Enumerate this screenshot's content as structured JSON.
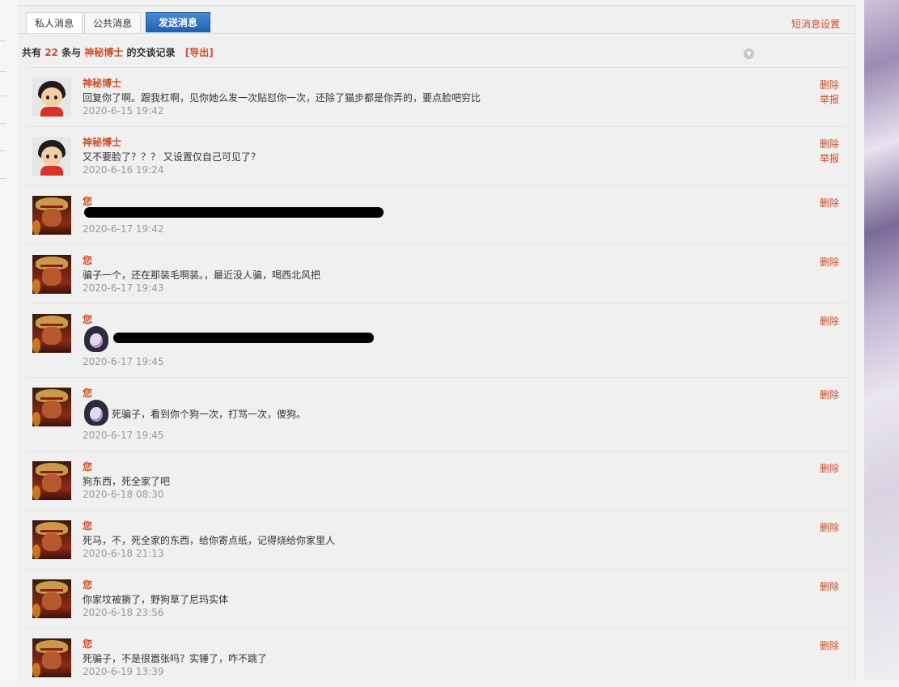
{
  "tabs": {
    "private": "私人消息",
    "public": "公共消息",
    "send": "发送消息"
  },
  "settings_link": "短消息设置",
  "summary": {
    "prefix": "共有",
    "count": "22",
    "mid": "条与",
    "partner": "神秘博士",
    "suffix": "的交谈记录",
    "export": "[导出]"
  },
  "actions": {
    "delete": "删除",
    "report": "举报"
  },
  "messages": [
    {
      "sender": "神秘博士",
      "avatar": "cartoon-boy-avatar",
      "text": "回复你了啊。跟我杠啊，见你她么发一次贴怼你一次，还除了猫步都是你弄的，要点脸吧穷比",
      "time": "2020-6-15 19:42"
    },
    {
      "sender": "神秘博士",
      "avatar": "cartoon-boy-avatar",
      "text": "又不要脸了？？？ 又设置仅自己可见了？",
      "time": "2020-6-16 19:24"
    },
    {
      "sender": "您",
      "avatar": "pirate-avatar",
      "text": "",
      "time": "2020-6-17 19:42"
    },
    {
      "sender": "您",
      "avatar": "pirate-avatar",
      "text": "骗子一个，还在那装毛啊装。，最近没人骗，喝西北风把",
      "time": "2020-6-17 19:43"
    },
    {
      "sender": "您",
      "avatar": "pirate-avatar",
      "text": "",
      "time": "2020-6-17 19:45"
    },
    {
      "sender": "您",
      "avatar": "pirate-avatar",
      "text": "死骗子，看到你个狗一次，打骂一次，傻狗。",
      "time": "2020-6-17 19:45"
    },
    {
      "sender": "您",
      "avatar": "pirate-avatar",
      "text": "狗东西，死全家了吧",
      "time": "2020-6-18 08:30"
    },
    {
      "sender": "您",
      "avatar": "pirate-avatar",
      "text": "死马，不，死全家的东西，给你寄点纸，记得烧给你家里人",
      "time": "2020-6-18 21:13"
    },
    {
      "sender": "您",
      "avatar": "pirate-avatar",
      "text": "你家坟被撅了，野狗草了尼玛实体",
      "time": "2020-6-18 23:56"
    },
    {
      "sender": "您",
      "avatar": "pirate-avatar",
      "text": "死骗子，不是很嚣张吗？实锤了，咋不跳了",
      "time": "2020-6-19 13:39"
    }
  ]
}
